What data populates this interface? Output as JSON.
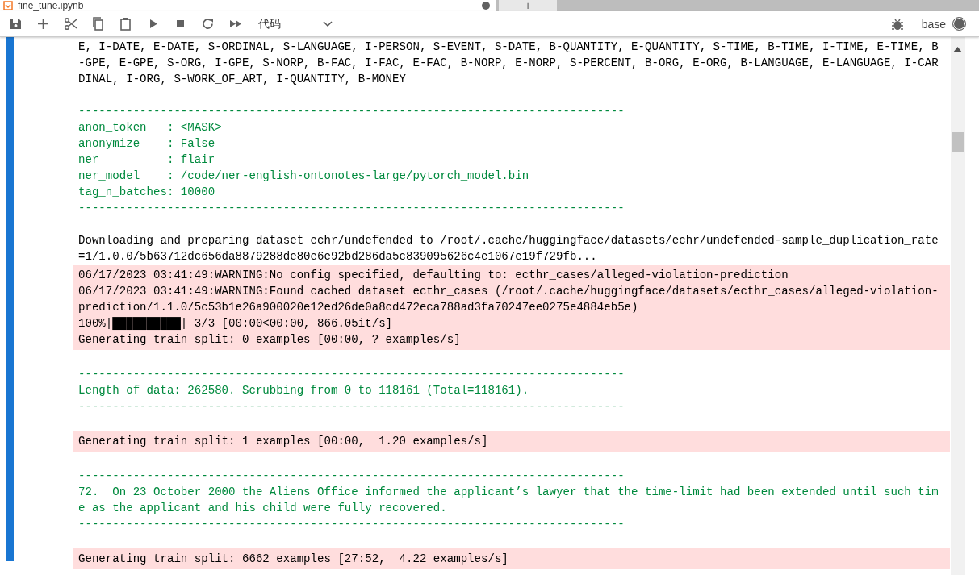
{
  "tabs": [
    {
      "label": "fine_tune.ipynb",
      "selected": true
    }
  ],
  "new_tab": {
    "label": "+"
  },
  "toolbar": {
    "cell_type": "代码",
    "kernel": "base",
    "kernel_busy": true
  },
  "outputs": [
    {
      "kind": "stdout",
      "lines": [
        {
          "kind": "plain",
          "text": "E, I-DATE, E-DATE, S-ORDINAL, S-LANGUAGE, I-PERSON, S-EVENT, S-DATE, B-QUANTITY, E-QUANTITY, S-TIME, B-TIME, I-TIME, E-TIME, B"
        },
        {
          "kind": "plain",
          "text": "-GPE, E-GPE, S-ORG, I-GPE, S-NORP, B-FAC, I-FAC, E-FAC, B-NORP, E-NORP, S-PERCENT, B-ORG, E-ORG, B-LANGUAGE, E-LANGUAGE, I-CAR"
        },
        {
          "kind": "plain",
          "text": "DINAL, I-ORG, S-WORK_OF_ART, I-QUANTITY, B-MONEY"
        },
        {
          "kind": "blank"
        },
        {
          "kind": "accent",
          "text": "--------------------------------------------------------------------------------"
        },
        {
          "kind": "accent",
          "text": "anon_token   : <MASK>"
        },
        {
          "kind": "accent",
          "text": "anonymize    : False"
        },
        {
          "kind": "accent",
          "text": "ner          : flair"
        },
        {
          "kind": "accent",
          "text": "ner_model    : /code/ner-english-ontonotes-large/pytorch_model.bin"
        },
        {
          "kind": "accent",
          "text": "tag_n_batches: 10000"
        },
        {
          "kind": "accent",
          "text": "--------------------------------------------------------------------------------"
        },
        {
          "kind": "blank"
        },
        {
          "kind": "plain",
          "text": "Downloading and preparing dataset echr/undefended to /root/.cache/huggingface/datasets/echr/undefended-sample_duplication_rate"
        },
        {
          "kind": "plain",
          "text": "=1/1.0.0/5b63712dc656da8879288de80e6e92bd286da5c839095626c4e1067e19f729fb..."
        }
      ]
    },
    {
      "kind": "stderr",
      "lines": [
        {
          "kind": "plain",
          "text": "06/17/2023 03:41:49:WARNING:No config specified, defaulting to: ecthr_cases/alleged-violation-prediction"
        },
        {
          "kind": "plain",
          "text": "06/17/2023 03:41:49:WARNING:Found cached dataset ecthr_cases (/root/.cache/huggingface/datasets/ecthr_cases/alleged-violation-"
        },
        {
          "kind": "plain",
          "text": "prediction/1.1.0/5c53b1e26a900020e12ed26de0a8cd472eca788ad3fa70247ee0275e4884eb5e)"
        },
        {
          "kind": "progress",
          "text": "100%|██████████| 3/3 [00:00<00:00, 866.05it/s]"
        },
        {
          "kind": "plain",
          "text": "Generating train split: 0 examples [00:00, ? examples/s]"
        }
      ]
    },
    {
      "kind": "stdout",
      "lines": [
        {
          "kind": "blank"
        },
        {
          "kind": "accent",
          "text": "--------------------------------------------------------------------------------"
        },
        {
          "kind": "accent",
          "text": "Length of data: 262580. Scrubbing from 0 to 118161 (Total=118161)."
        },
        {
          "kind": "accent",
          "text": "--------------------------------------------------------------------------------"
        },
        {
          "kind": "blank"
        }
      ]
    },
    {
      "kind": "stderr",
      "lines": [
        {
          "kind": "plain",
          "text": "Generating train split: 1 examples [00:00,  1.20 examples/s]"
        }
      ]
    },
    {
      "kind": "stdout",
      "lines": [
        {
          "kind": "blank"
        },
        {
          "kind": "accent",
          "text": "--------------------------------------------------------------------------------"
        },
        {
          "kind": "accent",
          "text": "72.  On 23 October 2000 the Aliens Office informed the applicant’s lawyer that the time-limit had been extended until such tim"
        },
        {
          "kind": "accent",
          "text": "e as the applicant and his child were fully recovered."
        },
        {
          "kind": "accent",
          "text": "--------------------------------------------------------------------------------"
        },
        {
          "kind": "blank"
        }
      ]
    },
    {
      "kind": "stderr",
      "lines": [
        {
          "kind": "plain",
          "text": "Generating train split: 6662 examples [27:52,  4.22 examples/s]"
        }
      ]
    }
  ]
}
